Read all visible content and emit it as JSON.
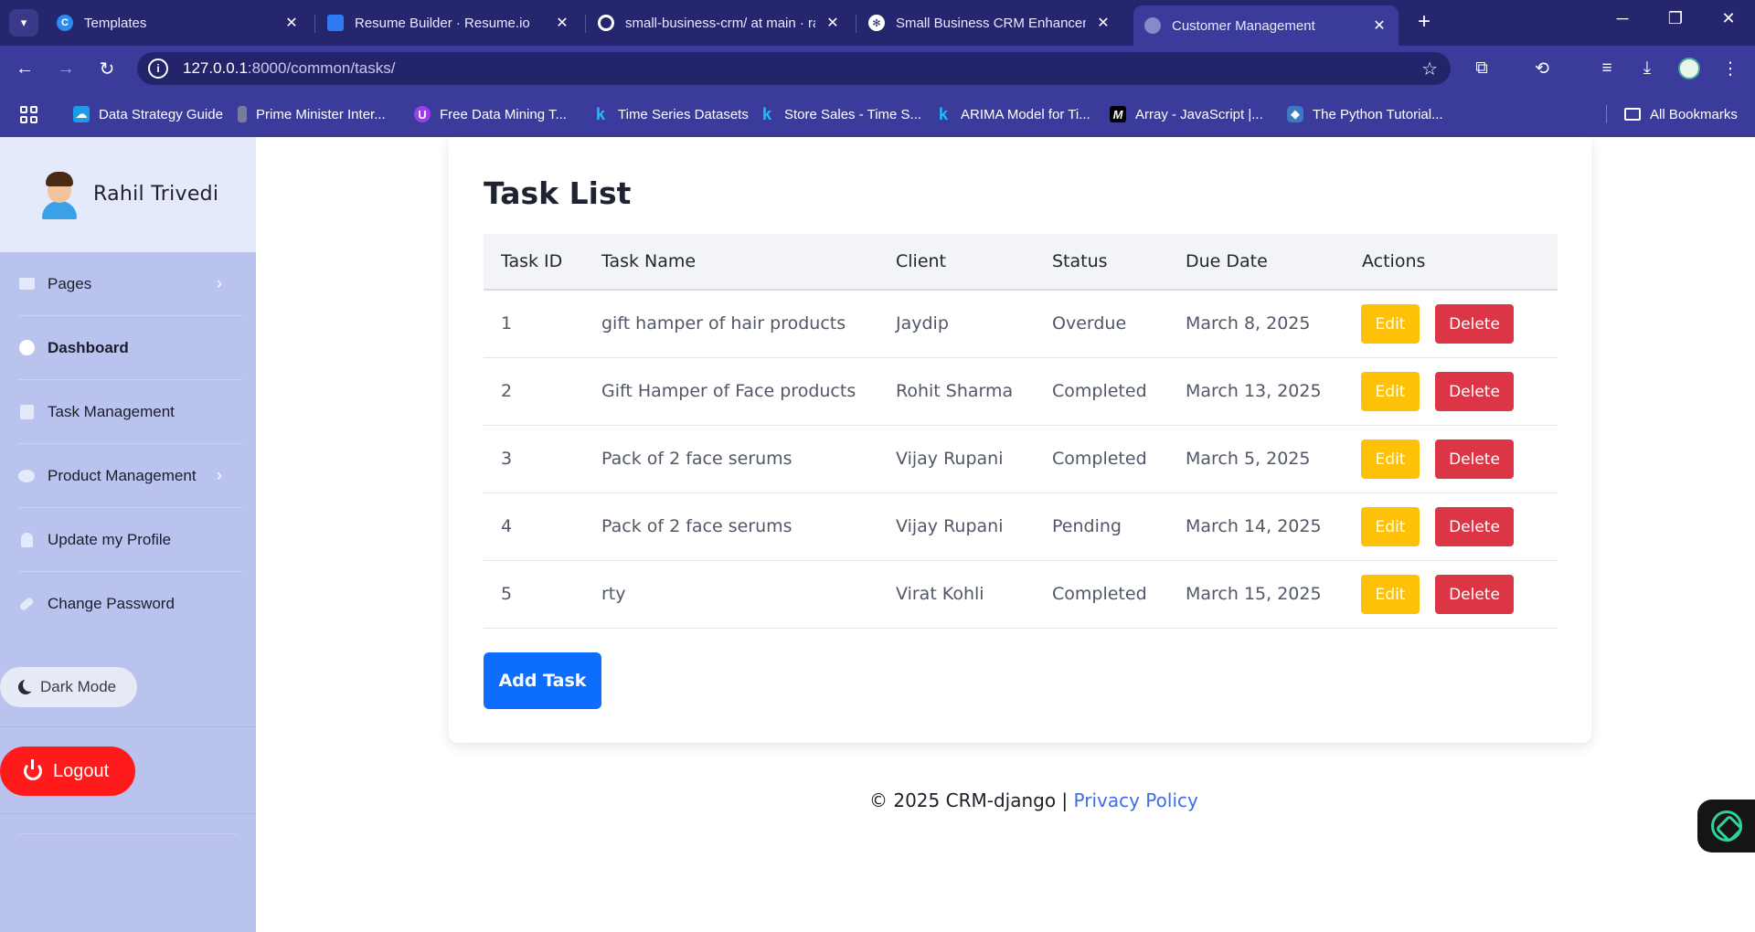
{
  "browser": {
    "tabs": [
      {
        "title": "Templates",
        "favicon_color": "#2b8cf0",
        "favicon_glyph": "C"
      },
      {
        "title": "Resume Builder · Resume.io",
        "favicon_color": "#2f7bf5",
        "favicon_glyph": "▪"
      },
      {
        "title": "small-business-crm/ at main · ra",
        "favicon_color": "#ffffff",
        "favicon_glyph": "●"
      },
      {
        "title": "Small Business CRM Enhanceme",
        "favicon_color": "#ffffff",
        "favicon_glyph": "✻"
      },
      {
        "title": "Customer Management",
        "favicon_color": "#8888cc",
        "favicon_glyph": "◍"
      }
    ],
    "url_host": "127.0.0.1",
    "url_path": ":8000/common/tasks/",
    "bookmarks": [
      {
        "label": "Data Strategy Guide",
        "icon_color": "#1e9be8",
        "icon_glyph": "☁"
      },
      {
        "label": "Prime Minister Inter...",
        "icon_color": "#7a7a9a",
        "icon_glyph": "▮"
      },
      {
        "label": "Free Data Mining T...",
        "icon_color": "#9b3dea",
        "icon_glyph": "U"
      },
      {
        "label": "Time Series Datasets",
        "icon_color": "#3b3b9c",
        "icon_glyph": "k"
      },
      {
        "label": "Store Sales - Time S...",
        "icon_color": "#3b3b9c",
        "icon_glyph": "k"
      },
      {
        "label": "ARIMA Model for Ti...",
        "icon_color": "#3b3b9c",
        "icon_glyph": "k"
      },
      {
        "label": "Array - JavaScript |...",
        "icon_color": "#000000",
        "icon_glyph": "M"
      },
      {
        "label": "The Python Tutorial...",
        "icon_color": "#3b7ac0",
        "icon_glyph": "◆"
      }
    ],
    "all_bookmarks": "All Bookmarks"
  },
  "sidebar": {
    "user_name": "Rahil Trivedi",
    "items": [
      {
        "label": "Pages",
        "icon": "folder-icon",
        "chevron": true,
        "bold": false
      },
      {
        "label": "Dashboard",
        "icon": "gauge-icon",
        "chevron": false,
        "bold": true
      },
      {
        "label": "Task Management",
        "icon": "calendar-icon",
        "chevron": false,
        "bold": false
      },
      {
        "label": "Product Management",
        "icon": "cogs-icon",
        "chevron": true,
        "bold": false
      },
      {
        "label": "Update my Profile",
        "icon": "user-icon",
        "chevron": false,
        "bold": false
      },
      {
        "label": "Change Password",
        "icon": "key-icon",
        "chevron": false,
        "bold": false
      }
    ],
    "dark_mode_label": "Dark Mode",
    "logout_label": "Logout"
  },
  "main": {
    "title": "Task List",
    "columns": [
      "Task ID",
      "Task Name",
      "Client",
      "Status",
      "Due Date",
      "Actions"
    ],
    "rows": [
      {
        "id": "1",
        "name": "gift hamper of hair products",
        "client": "Jaydip",
        "status": "Overdue",
        "due": "March 8, 2025"
      },
      {
        "id": "2",
        "name": "Gift Hamper of Face products",
        "client": "Rohit Sharma",
        "status": "Completed",
        "due": "March 13, 2025"
      },
      {
        "id": "3",
        "name": "Pack of 2 face serums",
        "client": "Vijay Rupani",
        "status": "Completed",
        "due": "March 5, 2025"
      },
      {
        "id": "4",
        "name": "Pack of 2 face serums",
        "client": "Vijay Rupani",
        "status": "Pending",
        "due": "March 14, 2025"
      },
      {
        "id": "5",
        "name": "rty",
        "client": "Virat Kohli",
        "status": "Completed",
        "due": "March 15, 2025"
      }
    ],
    "edit_label": "Edit",
    "delete_label": "Delete",
    "add_task_label": "Add Task"
  },
  "footer": {
    "copyright": "© 2025 CRM-django |",
    "privacy_link": "Privacy Policy"
  },
  "colors": {
    "edit": "#ffc107",
    "delete": "#dc3545",
    "primary": "#0d6efd",
    "logout": "#ff1b1b"
  }
}
